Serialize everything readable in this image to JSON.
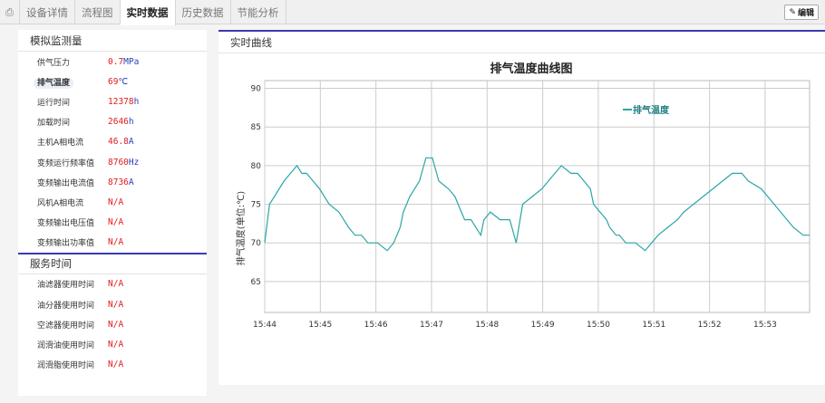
{
  "tabs": {
    "home_icon": "print-icon",
    "items": [
      {
        "label": "设备详情",
        "active": false
      },
      {
        "label": "流程图",
        "active": false
      },
      {
        "label": "实时数据",
        "active": true
      },
      {
        "label": "历史数据",
        "active": false
      },
      {
        "label": "节能分析",
        "active": false
      }
    ],
    "edit_label": "编辑"
  },
  "analog": {
    "title": "模拟监测量",
    "rows": [
      {
        "label": "供气压力",
        "value": "0.7",
        "unit": "MPa"
      },
      {
        "label": "排气温度",
        "value": "69",
        "unit": "℃",
        "highlight": true
      },
      {
        "label": "运行时间",
        "value": "12378",
        "unit": "h"
      },
      {
        "label": "加载时间",
        "value": "2646",
        "unit": "h"
      },
      {
        "label": "主机A相电流",
        "value": "46.8",
        "unit": "A"
      },
      {
        "label": "变频运行频率值",
        "value": "8760",
        "unit": "Hz"
      },
      {
        "label": "变频输出电流值",
        "value": "8736",
        "unit": "A"
      },
      {
        "label": "风机A相电流",
        "value": "N/A",
        "unit": ""
      },
      {
        "label": "变频输出电压值",
        "value": "N/A",
        "unit": ""
      },
      {
        "label": "变频输出功率值",
        "value": "N/A",
        "unit": ""
      }
    ]
  },
  "service": {
    "title": "服务时间",
    "rows": [
      {
        "label": "油滤器使用时间",
        "value": "N/A"
      },
      {
        "label": "油分器使用时间",
        "value": "N/A"
      },
      {
        "label": "空滤器使用时间",
        "value": "N/A"
      },
      {
        "label": "润滑油使用时间",
        "value": "N/A"
      },
      {
        "label": "润滑脂使用时间",
        "value": "N/A"
      }
    ]
  },
  "realtime": {
    "title": "实时曲线"
  },
  "colors": {
    "accent": "#3b3bb0",
    "value": "#e21b1b",
    "unit": "#2a3fb8",
    "line": "#2ba6a6"
  },
  "chart_data": {
    "type": "line",
    "title": "排气温度曲线图",
    "ylabel": "排气温度(单位:℃)",
    "xlabel": "",
    "ylim": [
      61,
      91
    ],
    "yticks": [
      65,
      70,
      75,
      80,
      85,
      90
    ],
    "xticks": [
      "15:44",
      "15:45",
      "15:46",
      "15:47",
      "15:48",
      "15:49",
      "15:50",
      "15:51",
      "15:52",
      "15:53"
    ],
    "grid": true,
    "legend_position": "top-right",
    "series": [
      {
        "name": "排气温度",
        "x": [
          0,
          0.15,
          0.3,
          0.6,
          1.0,
          1.15,
          1.3,
          1.5,
          1.7,
          2.0,
          2.3,
          2.6,
          2.8,
          3.0,
          3.2,
          3.5,
          3.8,
          4.0,
          4.2,
          4.3,
          4.5,
          4.8,
          5.0,
          5.2,
          5.4,
          5.7,
          5.9,
          6.1,
          6.2,
          6.4,
          6.55,
          6.7,
          6.8,
          7.0,
          7.3,
          7.6,
          7.8,
          8.0,
          8.3,
          8.6,
          8.8,
          9.0,
          9.2,
          9.5,
          9.7,
          9.9,
          10.1,
          10.2,
          10.4,
          10.6,
          10.7,
          10.9,
          11.0,
          11.2,
          11.5,
          11.8,
          12.0,
          12.2,
          12.5,
          12.8,
          13.0,
          13.3,
          13.6,
          13.9,
          14.2,
          14.5,
          14.8,
          15.0,
          15.4,
          15.8,
          16.2,
          16.4,
          16.7,
          16.9
        ]
      }
    ]
  }
}
